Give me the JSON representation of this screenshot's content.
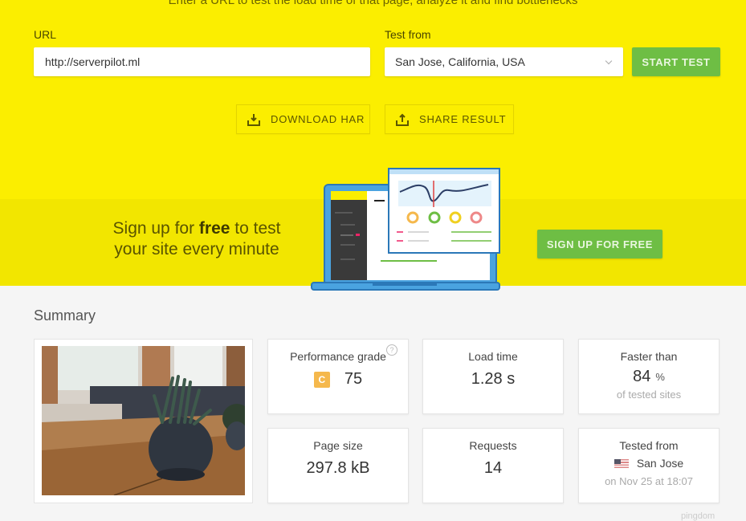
{
  "hero": {
    "tagline": "Enter a URL to test the load time of that page, analyze it and find bottlenecks",
    "url_label": "URL",
    "url_value": "http://serverpilot.ml",
    "test_from_label": "Test from",
    "test_from_selected": "San Jose, California, USA",
    "start_button": "START TEST",
    "download_button": "DOWNLOAD HAR",
    "share_button": "SHARE RESULT"
  },
  "promo": {
    "text_pre": "Sign up for ",
    "text_bold": "free",
    "text_post": " to test your site every minute",
    "signup_button": "SIGN UP FOR FREE"
  },
  "summary": {
    "title": "Summary",
    "performance": {
      "label": "Performance grade",
      "grade": "C",
      "score": "75",
      "help": "?"
    },
    "load_time": {
      "label": "Load time",
      "value": "1.28 s"
    },
    "faster_than": {
      "label": "Faster than",
      "value": "84",
      "unit": "%",
      "sub": "of tested sites"
    },
    "page_size": {
      "label": "Page size",
      "value": "297.8 kB"
    },
    "requests": {
      "label": "Requests",
      "value": "14"
    },
    "tested_from": {
      "label": "Tested from",
      "location": "San Jose",
      "date": "on Nov 25 at 18:07"
    }
  },
  "colors": {
    "hero_yellow": "#fbee00",
    "band_yellow": "#f2e600",
    "button_green": "#6ebe44",
    "grade_orange": "#f5b84c"
  },
  "watermark": "pingdom"
}
